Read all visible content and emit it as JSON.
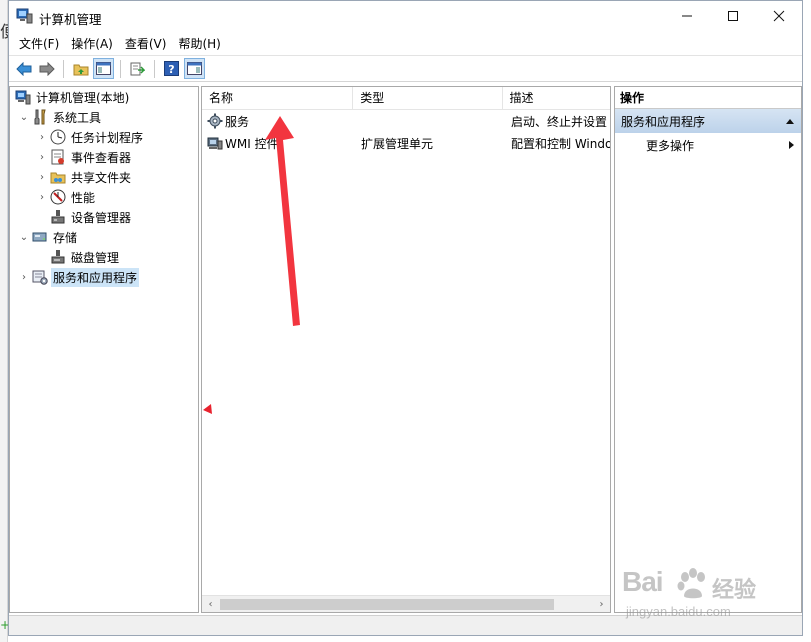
{
  "window": {
    "title": "计算机管理"
  },
  "menu": [
    "文件(F)",
    "操作(A)",
    "查看(V)",
    "帮助(H)"
  ],
  "tree": {
    "root": "计算机管理(本地)",
    "system_tools": "系统工具",
    "task_scheduler": "任务计划程序",
    "event_viewer": "事件查看器",
    "shared_folders": "共享文件夹",
    "performance": "性能",
    "device_manager": "设备管理器",
    "storage": "存储",
    "disk_management": "磁盘管理",
    "services_apps": "服务和应用程序"
  },
  "list": {
    "columns": [
      "名称",
      "类型",
      "描述"
    ],
    "rows": [
      {
        "name": "服务",
        "type": "",
        "desc": "启动、终止并设置"
      },
      {
        "name": "WMI 控件",
        "type": "扩展管理单元",
        "desc": "配置和控制 Windo"
      }
    ]
  },
  "actions": {
    "title": "操作",
    "section": "服务和应用程序",
    "more": "更多操作"
  },
  "watermark": {
    "brand": "Bai",
    "cn": "经验",
    "url": "jingyan.baidu.com"
  },
  "background": {
    "glyph": "便",
    "plus": "+"
  },
  "colors": {
    "accent": "#cce4f7",
    "annotation": "#f2353f",
    "section": "#c8dcf0"
  }
}
